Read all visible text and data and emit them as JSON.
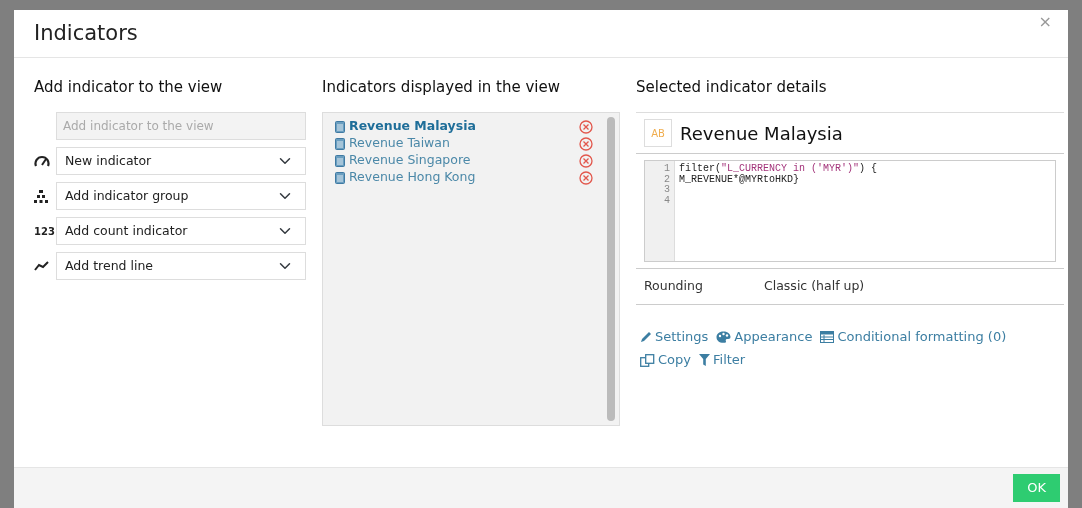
{
  "modal": {
    "title": "Indicators",
    "close": "×"
  },
  "add_panel": {
    "heading": "Add indicator to the view",
    "search": {
      "placeholder": "Add indicator to the view"
    },
    "selects": [
      {
        "kind": "gauge",
        "value": "New indicator"
      },
      {
        "kind": "group",
        "value": "Add indicator group"
      },
      {
        "kind": "count",
        "icon_text": "123",
        "value": "Add count indicator"
      },
      {
        "kind": "trend",
        "value": "Add trend line"
      }
    ]
  },
  "displayed_panel": {
    "heading": "Indicators displayed in the view",
    "items": [
      {
        "label": "Revenue Malaysia",
        "selected": true
      },
      {
        "label": "Revenue Taiwan",
        "selected": false
      },
      {
        "label": "Revenue Singapore",
        "selected": false
      },
      {
        "label": "Revenue Hong Kong",
        "selected": false
      }
    ]
  },
  "details_panel": {
    "heading": "Selected indicator details",
    "type_badge": "AB",
    "name": "Revenue Malaysia",
    "editor": {
      "line_numbers": [
        "1",
        "2",
        "3",
        "4"
      ],
      "lines": [
        [
          {
            "text": "filter(",
            "kind": "plain"
          },
          {
            "text": "\"L_CURRENCY in ('MYR')\"",
            "kind": "string"
          },
          {
            "text": ") {",
            "kind": "plain"
          }
        ],
        [
          {
            "text": "M_REVENUE*@MYRtoHKD}",
            "kind": "plain"
          }
        ]
      ]
    },
    "properties": [
      {
        "label": "Rounding",
        "value": "Classic (half up)"
      }
    ],
    "actions": [
      {
        "kind": "pencil",
        "label": "Settings"
      },
      {
        "kind": "palette",
        "label": "Appearance"
      },
      {
        "kind": "table",
        "label": "Conditional formatting (0)"
      },
      {
        "kind": "copy",
        "label": "Copy"
      },
      {
        "kind": "filter",
        "label": "Filter"
      }
    ]
  },
  "footer": {
    "ok": "OK"
  }
}
